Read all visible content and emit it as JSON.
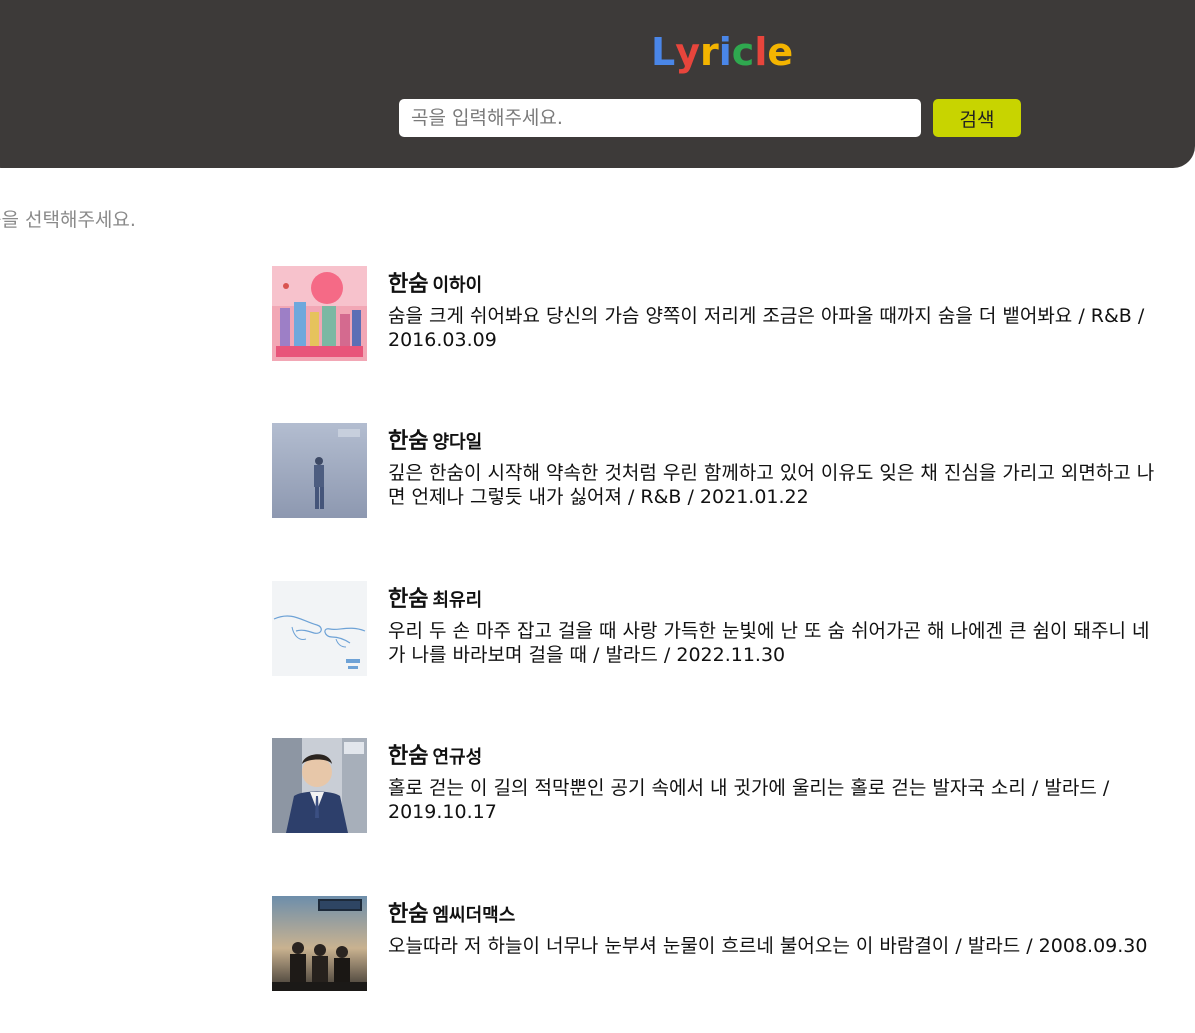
{
  "header": {
    "logo_letters": [
      {
        "char": "L",
        "color": "#4a86e8"
      },
      {
        "char": "y",
        "color": "#e8453c"
      },
      {
        "char": "r",
        "color": "#f4b400"
      },
      {
        "char": "i",
        "color": "#4a86e8"
      },
      {
        "char": "c",
        "color": "#2fa84f"
      },
      {
        "char": "l",
        "color": "#e8453c"
      },
      {
        "char": "e",
        "color": "#f4b400"
      }
    ],
    "search_placeholder": "곡을 입력해주세요.",
    "search_button_label": "검색"
  },
  "instruction": "곡을 선택해주세요.",
  "songs": [
    {
      "title": "한숨",
      "artist": "이하이",
      "lyrics": "숨을 크게 쉬어봐요 당신의 가슴 양쪽이 저리게 조금은 아파올 때까지 숨을 더 뱉어봐요",
      "genre": "R&B",
      "date": "2016.03.09",
      "line": "숨을 크게 쉬어봐요 당신의 가슴 양쪽이 저리게 조금은 아파올 때까지 숨을 더 뱉어봐요 / R&B / 2016.03.09"
    },
    {
      "title": "한숨",
      "artist": "양다일",
      "lyrics": "깊은 한숨이 시작해 약속한 것처럼 우린 함께하고 있어 이유도 잊은 채 진심을 가리고 외면하고 나면 언제나 그렇듯 내가 싫어져",
      "genre": "R&B",
      "date": "2021.01.22",
      "line": "깊은 한숨이 시작해 약속한 것처럼 우린 함께하고 있어 이유도 잊은 채 진심을 가리고 외면하고 나면 언제나 그렇듯 내가 싫어져 / R&B / 2021.01.22"
    },
    {
      "title": "한숨",
      "artist": "최유리",
      "lyrics": "우리 두 손 마주 잡고 걸을 때 사랑 가득한 눈빛에 난 또 숨 쉬어가곤 해 나에겐 큰 쉼이 돼주니 네가 나를 바라보며 걸을 때",
      "genre": "발라드",
      "date": "2022.11.30",
      "line": "우리 두 손 마주 잡고 걸을 때 사랑 가득한 눈빛에 난 또 숨 쉬어가곤 해 나에겐 큰 쉼이 돼주니 네가 나를 바라보며 걸을 때 / 발라드 / 2022.11.30"
    },
    {
      "title": "한숨",
      "artist": "연규성",
      "lyrics": "홀로 걷는 이 길의 적막뿐인 공기 속에서 내 귓가에 울리는 홀로 걷는 발자국 소리",
      "genre": "발라드",
      "date": "2019.10.17",
      "line": "홀로 걷는 이 길의 적막뿐인 공기 속에서 내 귓가에 울리는 홀로 걷는 발자국 소리 / 발라드 / 2019.10.17"
    },
    {
      "title": "한숨",
      "artist": "엠씨더맥스",
      "lyrics": "오늘따라 저 하늘이 너무나 눈부셔 눈물이 흐르네 불어오는 이 바람결이",
      "genre": "발라드",
      "date": "2008.09.30",
      "line": "오늘따라 저 하늘이 너무나 눈부셔 눈물이 흐르네 불어오는 이 바람결이 / 발라드 / 2008.09.30"
    }
  ]
}
